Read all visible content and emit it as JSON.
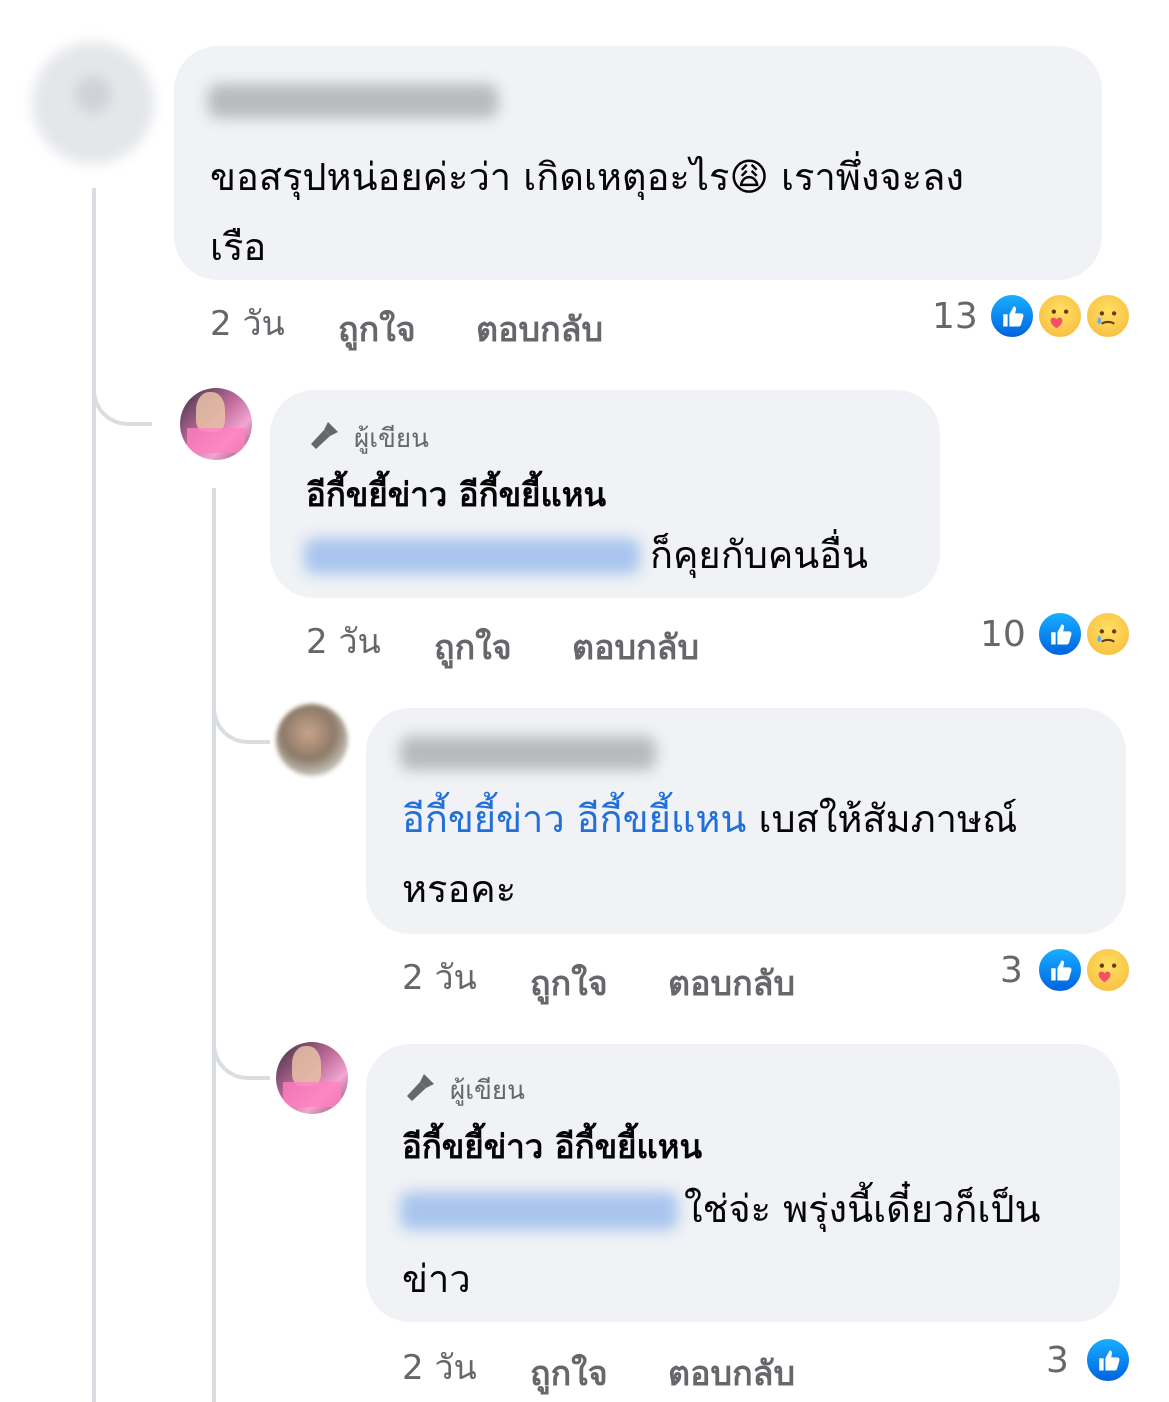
{
  "comments": [
    {
      "text_line1": "ขอสรุปหน่อยค่ะว่า เกิดเหตุอะไร😩 เราพึ่งจะลง",
      "text_line2": "เรือ",
      "time": "2 วัน",
      "like_label": "ถูกใจ",
      "reply_label": "ตอบกลับ",
      "reaction_count": "13",
      "reactions": [
        "like-icon",
        "care-icon",
        "sad-icon"
      ]
    },
    {
      "author_badge": "ผู้เขียน",
      "author": "อีกี้ขยี้ข่าว อีกี้ขยี้แหน",
      "text": "ก็คุยกับคนอื่น",
      "time": "2 วัน",
      "like_label": "ถูกใจ",
      "reply_label": "ตอบกลับ",
      "reaction_count": "10",
      "reactions": [
        "like-icon",
        "sad-icon"
      ]
    },
    {
      "mention": "อีกี้ขยี้ข่าว อีกี้ขยี้แหน",
      "text_line1": " เบสให้สัมภาษณ์",
      "text_line2": "หรอคะ",
      "time": "2 วัน",
      "like_label": "ถูกใจ",
      "reply_label": "ตอบกลับ",
      "reaction_count": "3",
      "reactions": [
        "like-icon",
        "care-icon"
      ]
    },
    {
      "author_badge": "ผู้เขียน",
      "author": "อีกี้ขยี้ข่าว อีกี้ขยี้แหน",
      "text_line1": "ใช่จ่ะ พรุ่งนี้เดี๋ยวก็เป็น",
      "text_line2": "ข่าว",
      "time": "2 วัน",
      "like_label": "ถูกใจ",
      "reply_label": "ตอบกลับ",
      "reaction_count": "3",
      "reactions": [
        "like-icon"
      ]
    }
  ],
  "colors": {
    "bubble": "#f0f2f5",
    "meta_text": "#65676b",
    "mention": "#216fdb",
    "like_blue": "#0866ff"
  }
}
